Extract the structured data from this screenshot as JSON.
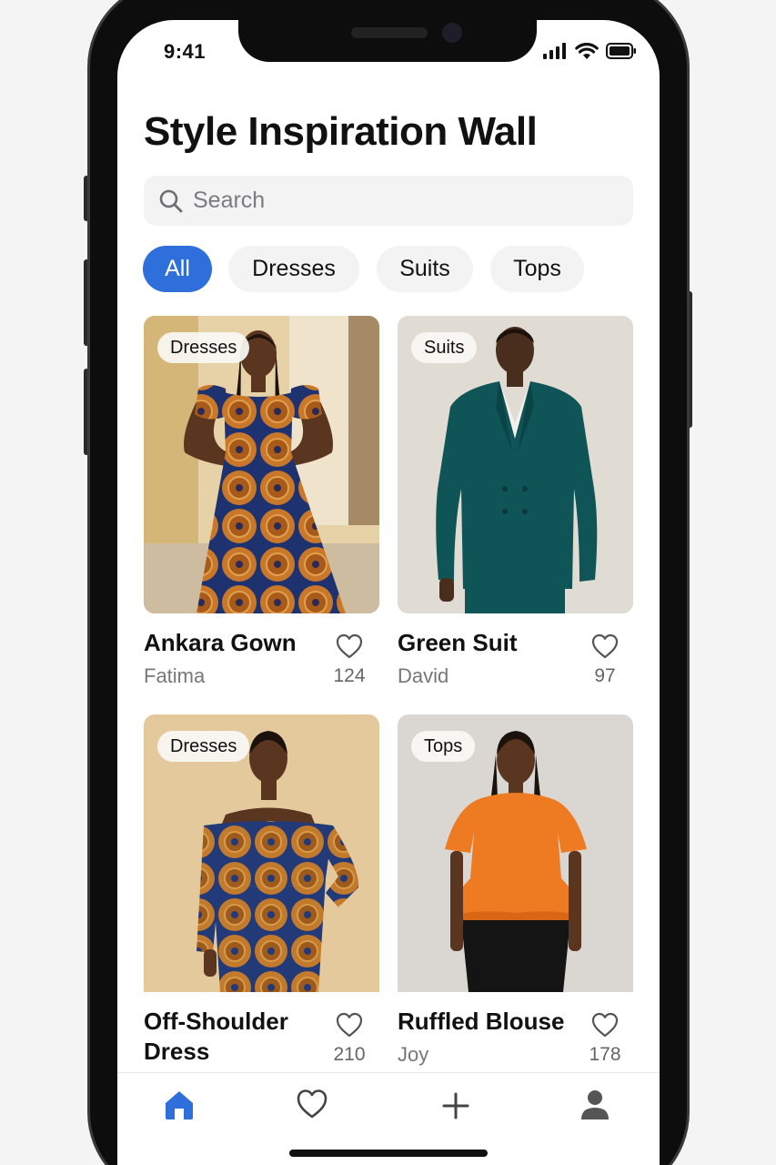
{
  "status_bar": {
    "time": "9:41",
    "icons": [
      "signal-icon",
      "wifi-icon",
      "battery-icon"
    ]
  },
  "header": {
    "title": "Style Inspiration Wall"
  },
  "search": {
    "placeholder": "Search"
  },
  "filters": [
    {
      "label": "All",
      "active": true
    },
    {
      "label": "Dresses",
      "active": false
    },
    {
      "label": "Suits",
      "active": false
    },
    {
      "label": "Tops",
      "active": false
    }
  ],
  "cards": [
    {
      "tag": "Dresses",
      "title": "Ankara Gown",
      "author": "Fatima",
      "likes": "124"
    },
    {
      "tag": "Suits",
      "title": "Green Suit",
      "author": "David",
      "likes": "97"
    },
    {
      "tag": "Dresses",
      "title": "Off-Shoulder Dress",
      "author": "",
      "likes": "210"
    },
    {
      "tag": "Tops",
      "title": "Ruffled Blouse",
      "author": "Joy",
      "likes": "178"
    }
  ],
  "tab_bar": {
    "items": [
      {
        "icon": "home-icon",
        "active": true
      },
      {
        "icon": "heart-icon",
        "active": false
      },
      {
        "icon": "plus-icon",
        "active": false
      },
      {
        "icon": "profile-icon",
        "active": false
      }
    ]
  },
  "colors": {
    "accent": "#2f6fdc",
    "background": "#ffffff",
    "chip": "#f3f3f4",
    "text": "#111111"
  }
}
